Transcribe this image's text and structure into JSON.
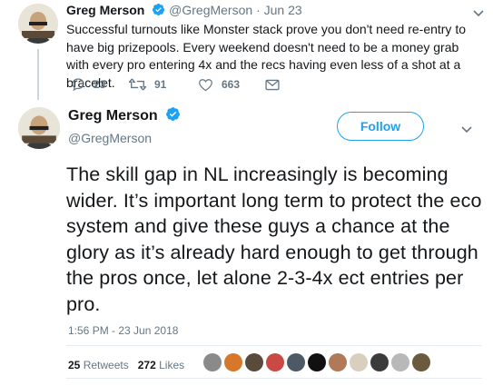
{
  "reply": {
    "name": "Greg Merson",
    "handle": "@GregMerson",
    "separator": "·",
    "date": "Jun 23",
    "text": "Successful turnouts like Monster stack prove you don't need re-entry to have big prizepools. Every weekend doesn't need to be a money grab with every pro entering 4x and the recs having even less of a shot at a bracelet.",
    "actions": {
      "replies": "23",
      "retweets": "91",
      "likes": "663"
    }
  },
  "tweet": {
    "name": "Greg Merson",
    "handle": "@GregMerson",
    "follow_label": "Follow",
    "text": "The skill gap in NL increasingly is becoming wider. It’s important long term to protect the eco system and give these guys a chance at the glory as it’s already hard enough to get through the pros once, let alone 2-3-4x ect entries per pro.",
    "timestamp": "1:56 PM - 23 Jun 2018",
    "retweet_count": "25",
    "retweet_label": "Retweets",
    "like_count": "272",
    "like_label": "Likes"
  },
  "colors": {
    "brand_blue": "#1da1f2",
    "secondary_text": "#657786",
    "divider": "#e6ecf0",
    "thread_line": "#ccd6dd"
  },
  "icons": [
    "avatar",
    "verified-badge-icon",
    "chevron-down-icon",
    "reply-icon",
    "retweet-icon",
    "like-icon",
    "direct-message-icon"
  ],
  "likers": [
    {
      "color": "#8a8a8a"
    },
    {
      "color": "#d6772b"
    },
    {
      "color": "#5a4a3a"
    },
    {
      "color": "#c94a44"
    },
    {
      "color": "#4d5a66"
    },
    {
      "color": "#111111"
    },
    {
      "color": "#b0795a"
    },
    {
      "color": "#d9cfc0"
    },
    {
      "color": "#3b3b3b"
    },
    {
      "color": "#b8b8b8"
    },
    {
      "color": "#6a5a3e"
    }
  ]
}
